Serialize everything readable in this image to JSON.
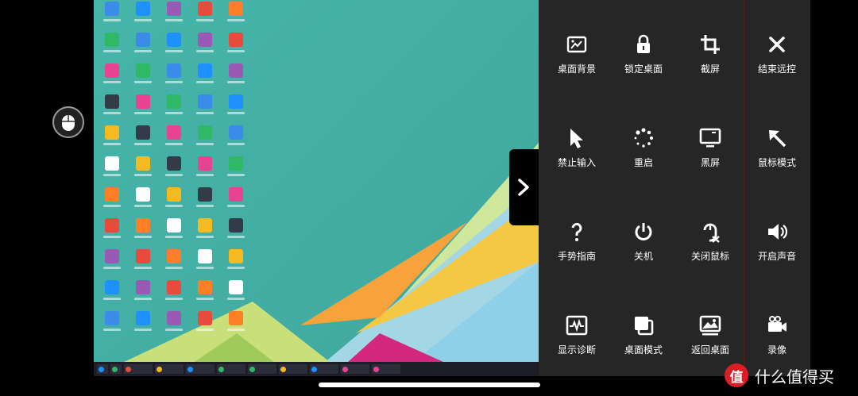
{
  "panel": {
    "items": [
      {
        "label": "桌面背景",
        "icon": "wallpaper-icon"
      },
      {
        "label": "锁定桌面",
        "icon": "lock-icon"
      },
      {
        "label": "截屏",
        "icon": "crop-icon"
      },
      {
        "label": "结束远控",
        "icon": "close-icon"
      },
      {
        "label": "禁止输入",
        "icon": "cursor-icon"
      },
      {
        "label": "重启",
        "icon": "spinner-icon"
      },
      {
        "label": "黑屏",
        "icon": "monitor-icon"
      },
      {
        "label": "鼠标模式",
        "icon": "arrow-up-left-icon"
      },
      {
        "label": "手势指南",
        "icon": "question-icon"
      },
      {
        "label": "关机",
        "icon": "power-icon"
      },
      {
        "label": "关闭鼠标",
        "icon": "mouse-off-icon"
      },
      {
        "label": "开启声音",
        "icon": "speaker-icon"
      },
      {
        "label": "显示诊断",
        "icon": "diagnostic-icon"
      },
      {
        "label": "桌面模式",
        "icon": "windows-stack-icon"
      },
      {
        "label": "返回桌面",
        "icon": "picture-icon"
      },
      {
        "label": "录像",
        "icon": "video-camera-icon"
      }
    ]
  },
  "watermark": {
    "logo": "值",
    "text": "什么值得买"
  },
  "colors": {
    "panel_bg": "#262626",
    "accent_red": "#d81f26"
  }
}
